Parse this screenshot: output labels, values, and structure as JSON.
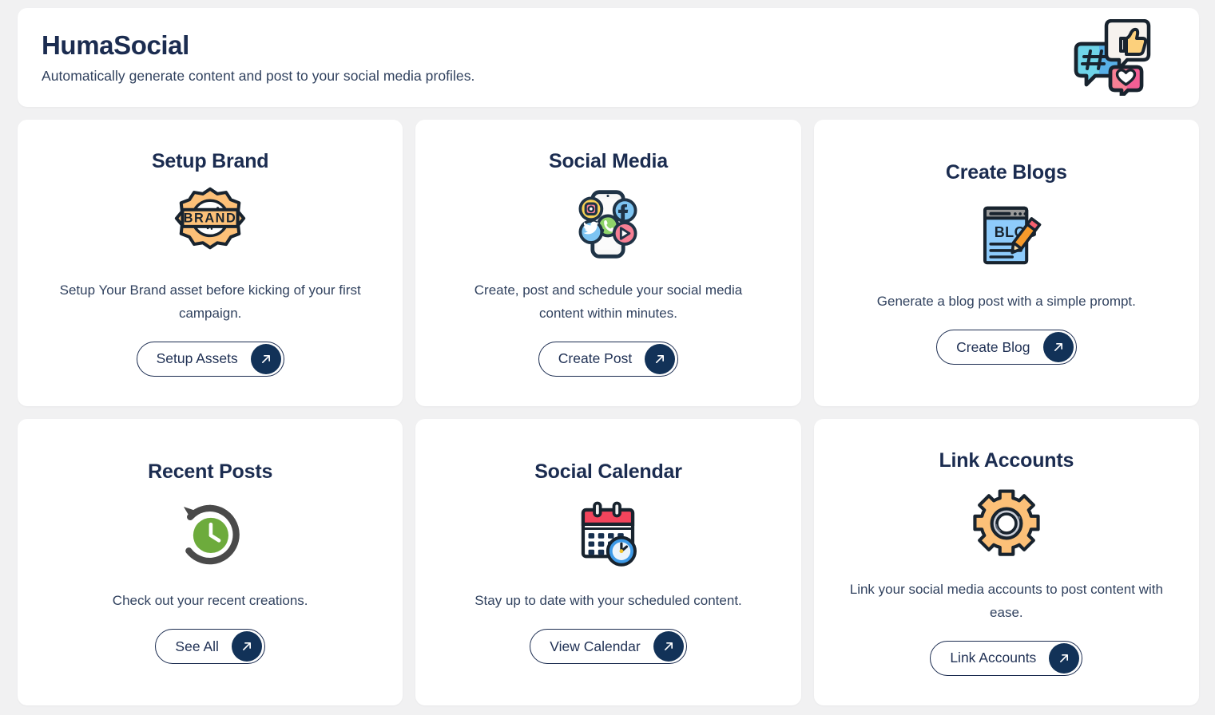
{
  "header": {
    "title": "HumaSocial",
    "subtitle": "Automatically generate content and post to your social media profiles.",
    "icon": "social-bubbles-icon"
  },
  "colors": {
    "page_background": "#f1f1f2",
    "card_background": "#ffffff",
    "title_navy": "#1b2c50",
    "body_text": "#31425f",
    "button_circle": "#123258"
  },
  "cards": [
    {
      "title": "Setup Brand",
      "icon": "brand-badge-icon",
      "description": "Setup Your Brand asset before kicking of your first campaign.",
      "button_label": "Setup Assets",
      "button_icon": "arrow-up-right-icon"
    },
    {
      "title": "Social Media",
      "icon": "social-phone-icon",
      "description": "Create, post and schedule your social media content within minutes.",
      "button_label": "Create Post",
      "button_icon": "arrow-up-right-icon"
    },
    {
      "title": "Create Blogs",
      "icon": "blog-pencil-icon",
      "description": "Generate a blog post with a simple prompt.",
      "button_label": "Create Blog",
      "button_icon": "arrow-up-right-icon"
    },
    {
      "title": "Recent Posts",
      "icon": "history-clock-icon",
      "description": "Check out your recent creations.",
      "button_label": "See All",
      "button_icon": "arrow-up-right-icon"
    },
    {
      "title": "Social Calendar",
      "icon": "calendar-clock-icon",
      "description": "Stay up to date with your scheduled content.",
      "button_label": "View Calendar",
      "button_icon": "arrow-up-right-icon"
    },
    {
      "title": "Link Accounts",
      "icon": "gear-icon",
      "description": "Link your social media accounts to post content with ease.",
      "button_label": "Link Accounts",
      "button_icon": "arrow-up-right-icon"
    }
  ]
}
